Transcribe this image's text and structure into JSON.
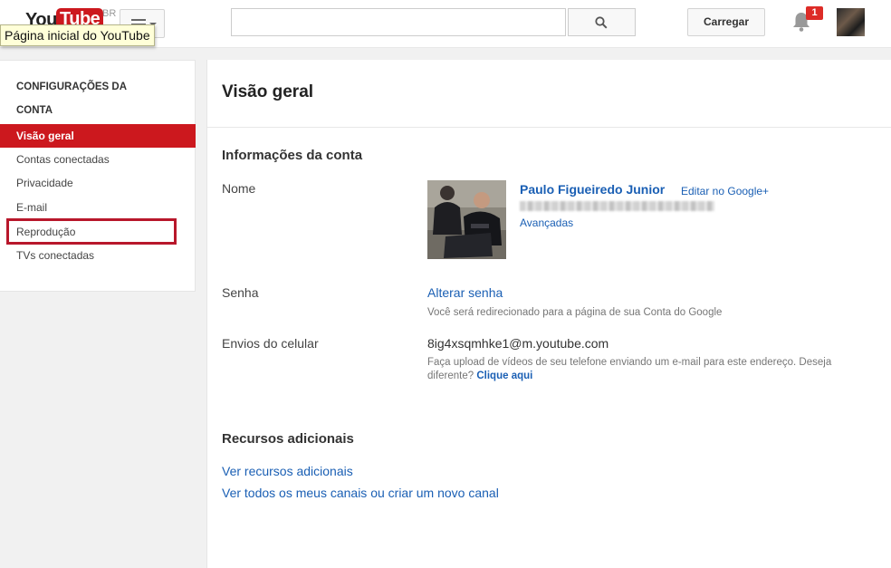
{
  "header": {
    "logo_you": "You",
    "logo_tube": "Tube",
    "logo_region": "BR",
    "tooltip": "Página inicial do YouTube",
    "search_placeholder": "",
    "upload_label": "Carregar",
    "notification_count": "1",
    "icons": {
      "search": "search-icon",
      "guide": "menu-icon",
      "notifications": "bell-icon"
    }
  },
  "sidebar": {
    "heading_line1": "CONFIGURAÇÕES DA",
    "heading_line2": "CONTA",
    "items": [
      {
        "label": "Visão geral",
        "active": true
      },
      {
        "label": "Contas conectadas",
        "active": false
      },
      {
        "label": "Privacidade",
        "active": false
      },
      {
        "label": "E-mail",
        "active": false
      },
      {
        "label": "Reprodução",
        "active": false,
        "highlighted": true
      },
      {
        "label": "TVs conectadas",
        "active": false
      }
    ]
  },
  "main": {
    "page_title": "Visão geral",
    "account_info": {
      "title": "Informações da conta",
      "name_label": "Nome",
      "name_value": "Paulo Figueiredo Junior",
      "edit_link": "Editar no Google+",
      "advanced_link": "Avançadas",
      "password_label": "Senha",
      "password_link": "Alterar senha",
      "password_note": "Você será redirecionado para a página de sua Conta do Google",
      "mobile_label": "Envios do celular",
      "mobile_value": "8ig4xsqmhke1@m.youtube.com",
      "mobile_note_line1": "Faça upload de vídeos de seu telefone enviando um e-mail para este endereço. Deseja",
      "mobile_note_line2": "diferente?",
      "mobile_note_link": "Clique aqui"
    },
    "additional": {
      "title": "Recursos adicionais",
      "link1": "Ver recursos adicionais",
      "link2": "Ver todos os meus canais ou criar um novo canal"
    }
  },
  "colors": {
    "brand_red": "#cc181e",
    "link_blue": "#1a5fb4",
    "highlight_border": "#b8172b"
  }
}
